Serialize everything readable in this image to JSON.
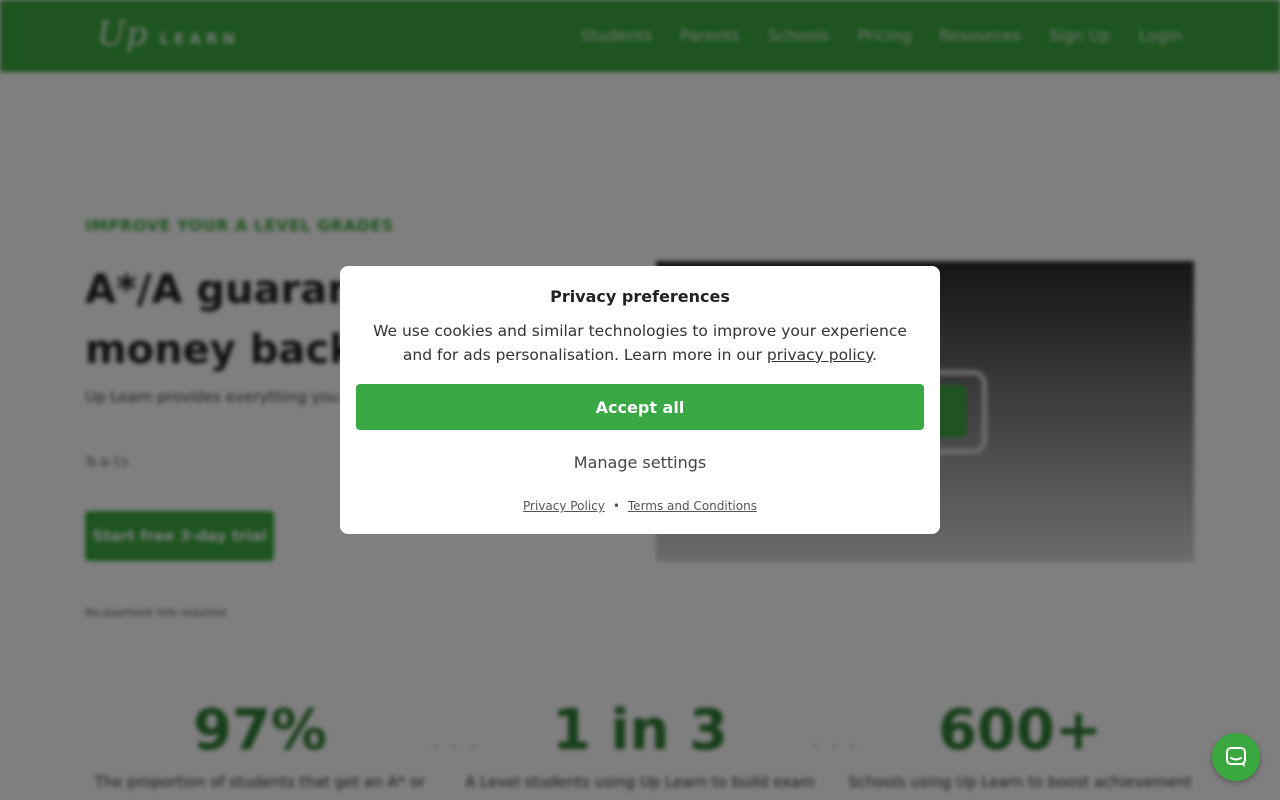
{
  "nav": {
    "logo_up": "Up",
    "logo_learn": "LEARN",
    "links": [
      "Students",
      "Parents",
      "Schools",
      "Pricing",
      "Resources",
      "Sign Up",
      "Login"
    ]
  },
  "hero": {
    "eyebrow": "IMPROVE YOUR A LEVEL GRADES",
    "title_line1": "A*/A guarant",
    "title_line2": "money back",
    "desc": "Up Learn provides everything you subject, as efficiently as possible.",
    "tcs": "Ts & Cs",
    "cta": "Start free 3-day trial",
    "no_payment": "No payment info required"
  },
  "stats": [
    {
      "num": "97%",
      "label": "The proportion of students that get an A* or"
    },
    {
      "num": "1 in 3",
      "label": "A Level students using Up Learn to build exam"
    },
    {
      "num": "600+",
      "label": "Schools using Up Learn to boost achievement"
    }
  ],
  "modal": {
    "title": "Privacy preferences",
    "body_text": "We use cookies and similar technologies to improve your experience and for ads personalisation. Learn more in our ",
    "body_link": "privacy policy",
    "body_end": ".",
    "accept": "Accept all",
    "manage": "Manage settings",
    "footer_privacy": "Privacy Policy",
    "footer_sep": "•",
    "footer_terms": "Terms and Conditions"
  },
  "colors": {
    "brand_green": "#3aa83f",
    "overlay": "rgba(0,0,0,0.5)"
  },
  "icons": {
    "chat": "chat-bubble-icon"
  }
}
